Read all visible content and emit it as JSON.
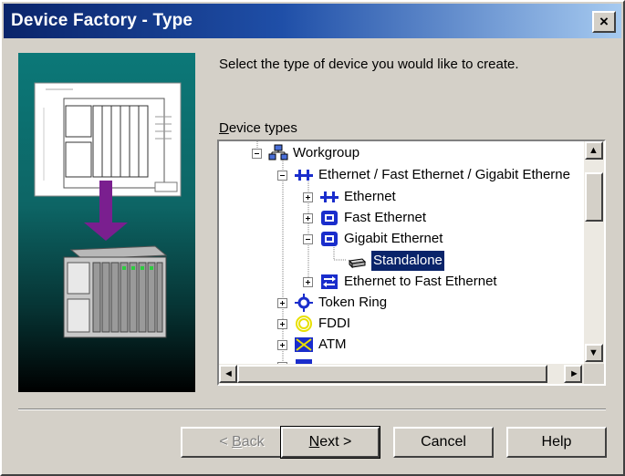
{
  "window": {
    "title": "Device Factory - Type",
    "close_glyph": "×"
  },
  "instruction": "Select the type of device you would like to create.",
  "tree": {
    "label_hotkey": "D",
    "label_rest": "evice types",
    "items": [
      {
        "label": "Workgroup",
        "icon": "workgroup-icon",
        "expander": "minus"
      },
      {
        "label": "Ethernet / Fast Ethernet / Gigabit Etherne",
        "icon": "ethernet-icon",
        "expander": "minus"
      },
      {
        "label": "Ethernet",
        "icon": "ethernet-icon",
        "expander": "plus"
      },
      {
        "label": "Fast Ethernet",
        "icon": "fast-ethernet-icon",
        "expander": "plus"
      },
      {
        "label": "Gigabit Ethernet",
        "icon": "gigabit-ethernet-icon",
        "expander": "minus"
      },
      {
        "label": "Standalone",
        "icon": "standalone-device-icon",
        "expander": "none",
        "selected": true
      },
      {
        "label": "Ethernet to Fast Ethernet",
        "icon": "ethernet-bridge-icon",
        "expander": "plus"
      },
      {
        "label": "Token Ring",
        "icon": "token-ring-icon",
        "expander": "plus"
      },
      {
        "label": "FDDI",
        "icon": "fddi-icon",
        "expander": "plus"
      },
      {
        "label": "ATM",
        "icon": "atm-icon",
        "expander": "plus"
      }
    ],
    "scroll_glyphs": {
      "up": "▲",
      "down": "▼",
      "left": "◄",
      "right": "►"
    }
  },
  "buttons": {
    "back_prefix": "< ",
    "back_hotkey": "B",
    "back_rest": "ack",
    "next_hotkey": "N",
    "next_rest": "ext >",
    "cancel": "Cancel",
    "help": "Help"
  },
  "colors": {
    "accent": "#0a246a",
    "selection": "#0a246a",
    "panel_teal": "#0c7878",
    "arrow_purple": "#7a1f8f"
  }
}
